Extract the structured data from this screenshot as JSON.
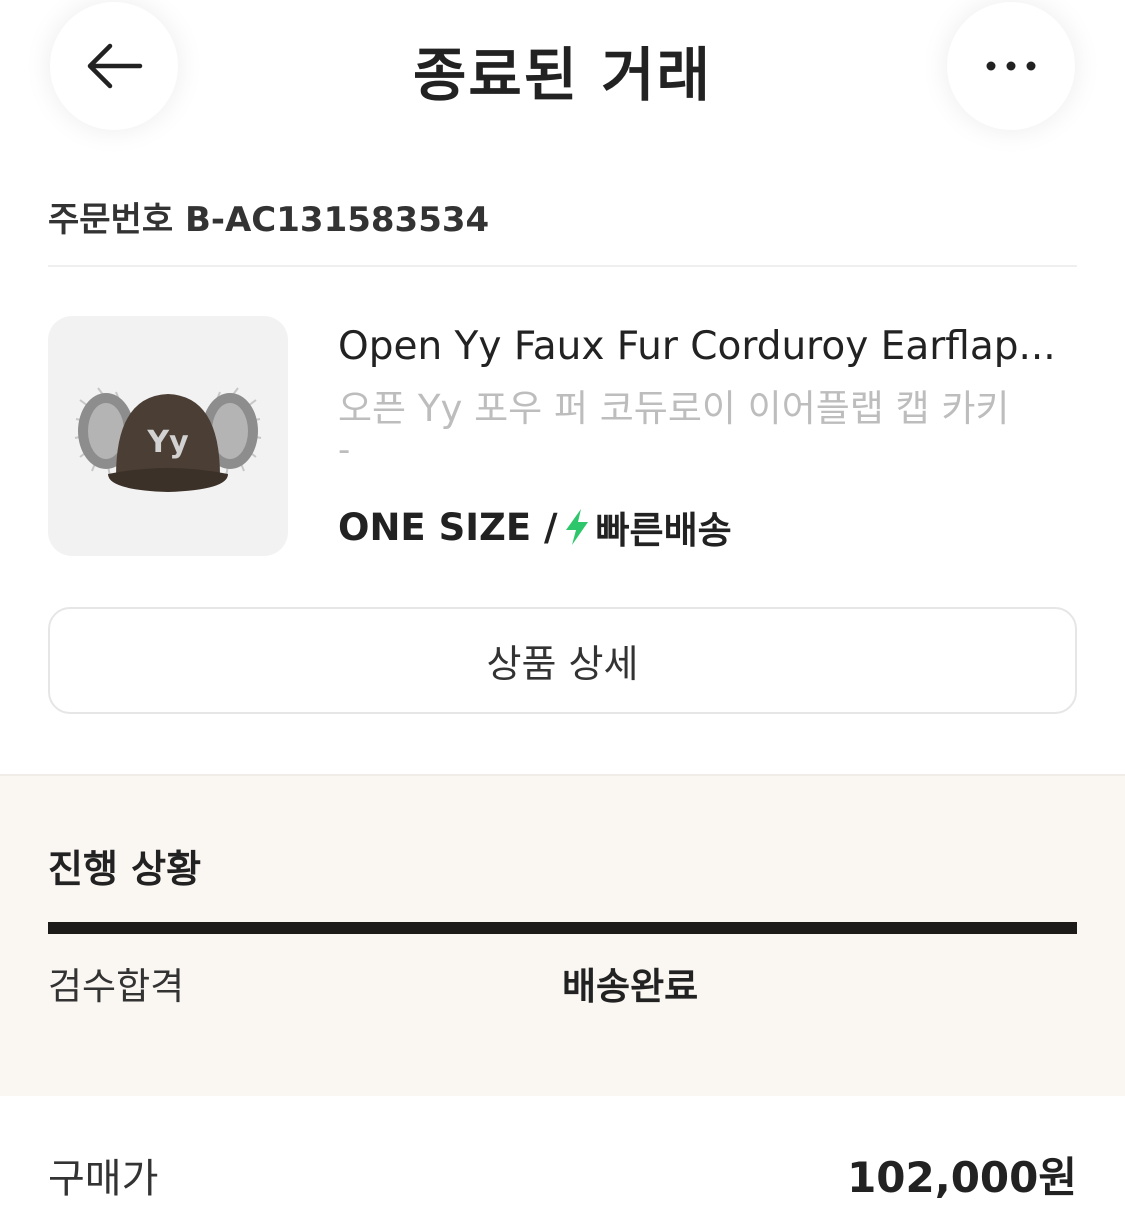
{
  "header": {
    "title": "종료된 거래",
    "back_icon": "arrow-left-icon",
    "more_icon": "more-horizontal-icon"
  },
  "order": {
    "label": "주문번호",
    "number": "B-AC131583534",
    "display": "주문번호 B-AC131583534"
  },
  "product": {
    "name": "Open Yy Faux Fur Corduroy Earflap...",
    "name_ko": "오픈 Yy 포우 퍼 코듀로이 이어플랩 캡 카키",
    "dash": "-",
    "size": "ONE SIZE /",
    "shipping": "빠른배송",
    "shipping_icon": "lightning-icon",
    "shipping_color": "#2ec66a",
    "thumbnail_logo": "Yy"
  },
  "detail_button": {
    "label": "상품 상세"
  },
  "progress": {
    "title": "진행 상황",
    "steps": [
      "검수합격",
      "배송완료"
    ]
  },
  "price": {
    "label": "구매가",
    "value": "102,000원"
  }
}
